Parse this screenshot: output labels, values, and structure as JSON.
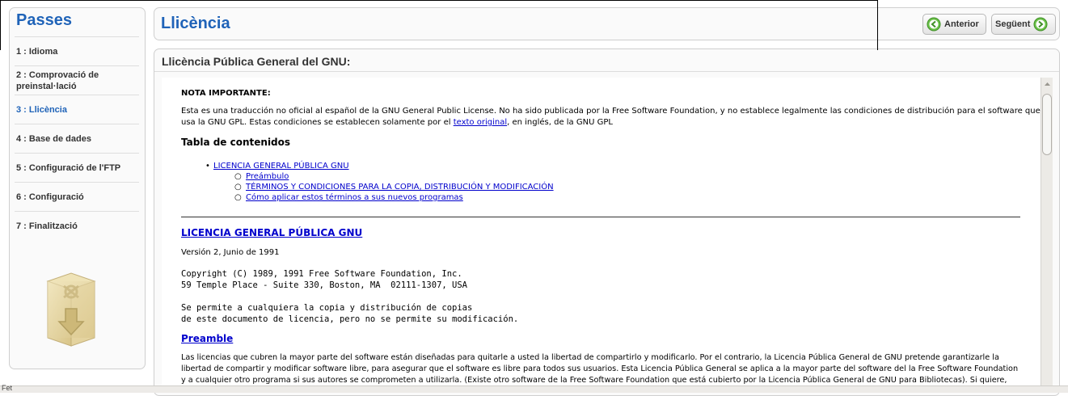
{
  "sidebar": {
    "title": "Passes",
    "steps": [
      {
        "label": "1 : Idioma"
      },
      {
        "label": "2 : Comprovació de preinstal·lació"
      },
      {
        "label": "3 : Llicència"
      },
      {
        "label": "4 : Base de dades"
      },
      {
        "label": "5 : Configuració de l'FTP"
      },
      {
        "label": "6 : Configuració"
      },
      {
        "label": "7 : Finalització"
      }
    ],
    "active_step": 3,
    "icon": "joomla-install-box-icon"
  },
  "header": {
    "title": "Llicència",
    "prev_label": "Anterior",
    "next_label": "Següent",
    "prev_icon": "arrow-left-icon",
    "next_icon": "arrow-right-icon"
  },
  "main": {
    "title": "Llicència Pública General del GNU:"
  },
  "license": {
    "note_title": "NOTA IMPORTANTE:",
    "note_line1": "Esta es una traducción no oficial al español de la GNU General Public License. No ha sido publicada por la Free Software Foundation, y no establece legalmente las condiciones de distribución para el software que",
    "note_line2_pre": "usa la GNU GPL. Estas condiciones se establecen solamente por el ",
    "note_line2_link": "texto original",
    "note_line2_post": ", en inglés, de la GNU GPL",
    "toc_title": "Tabla de contenidos",
    "toc_main": "LICENCIA GENERAL PÚBLICA GNU",
    "toc_sub": [
      "Preámbulo",
      "TÉRMINOS Y CONDICIONES PARA LA COPIA, DISTRIBUCIÓN Y MODIFICACIÓN",
      "Cómo aplicar estos términos a sus nuevos programas"
    ],
    "heading": "LICENCIA GENERAL PÚBLICA GNU",
    "version": "Versión 2, Junio de 1991",
    "copyright_line1": "Copyright (C) 1989, 1991 Free Software Foundation, Inc.",
    "copyright_line2": "59 Temple Place - Suite 330, Boston, MA  02111-1307, USA",
    "permit_line1": "Se permite a cualquiera la copia y distribución de copias",
    "permit_line2": "de este documento de licencia, pero no se permite su modificación.",
    "preamble_heading": "Preamble",
    "preamble_line1": "Las licencias que cubren la mayor parte del software están diseñadas para quitarle a usted la libertad de compartirlo y modificarlo. Por el contrario, la Licencia Pública General de GNU pretende garantizarle la",
    "preamble_line2": "libertad de compartir y modificar software libre, para asegurar que el software es libre para todos sus usuarios. Esta Licencia Pública General se aplica a la mayor parte del software del la Free Software Foundation",
    "preamble_line3": "y a cualquier otro programa si sus autores se comprometen a utilizarla. (Existe otro software de la Free Software Foundation que está cubierto por la Licencia Pública General de GNU para Bibliotecas). Si quiere,"
  },
  "statusbar": {
    "text": "Fet"
  },
  "colors": {
    "accent": "#1f63b8",
    "link": "#0000cc",
    "button_green": "#6cc24a"
  }
}
